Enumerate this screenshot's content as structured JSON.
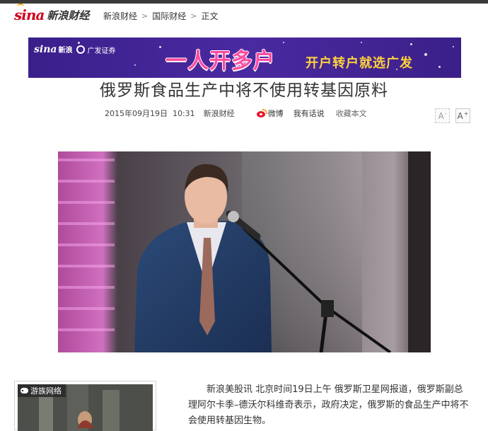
{
  "header": {
    "logo_brand": "sina",
    "logo_name": "新浪财经",
    "breadcrumb": [
      "新浪财经",
      "国际财经",
      "正文"
    ],
    "breadcrumb_separator": ">"
  },
  "banner": {
    "brand_logo": "sina",
    "brand_logo_sub": "新浪",
    "partner_logo": "广发证券",
    "headline": "一人开多户",
    "slogan": "开户转户就选广发"
  },
  "article": {
    "title": "俄罗斯食品生产中将不使用转基因原料",
    "datetime": "2015年09月19日  10:31",
    "source": "新浪财经",
    "share_weibo": "微博",
    "comment_link": "我有话说",
    "favorite_link": "收藏本文",
    "font_smaller": "A",
    "font_larger": "A",
    "body": "新浪美股讯 北京时间19日上午 俄罗斯卫星网报道，俄罗斯副总理阿尔卡季–德沃尔科维奇表示，政府决定，俄罗斯的食品生产中将不会使用转基因生物。"
  },
  "sidebar_ad": {
    "tag": "游族网络"
  },
  "icons": {
    "weibo": "weibo-icon",
    "font_decrease": "font-decrease-icon",
    "font_increase": "font-increase-icon",
    "gamepad": "gamepad-icon"
  },
  "colors": {
    "brand_red": "#d0021b",
    "banner_bg": "#3f2394",
    "banner_headline": "#ff4aa0",
    "banner_slogan": "#ffd23a"
  }
}
